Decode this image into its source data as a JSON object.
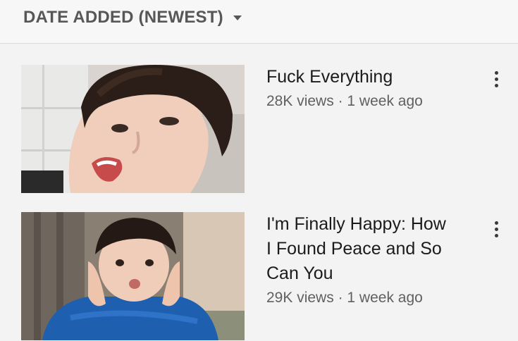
{
  "sort": {
    "label": "DATE ADDED (NEWEST)",
    "icon": "caret-down-icon"
  },
  "videos": [
    {
      "title": "Fuck Everything",
      "views": "28K views",
      "separator": "·",
      "age": "1 week ago",
      "menu_icon": "more-vert-icon"
    },
    {
      "title": "I'm Finally Happy: How I Found Peace and So Can You",
      "views": "29K views",
      "separator": "·",
      "age": "1 week ago",
      "menu_icon": "more-vert-icon"
    }
  ]
}
